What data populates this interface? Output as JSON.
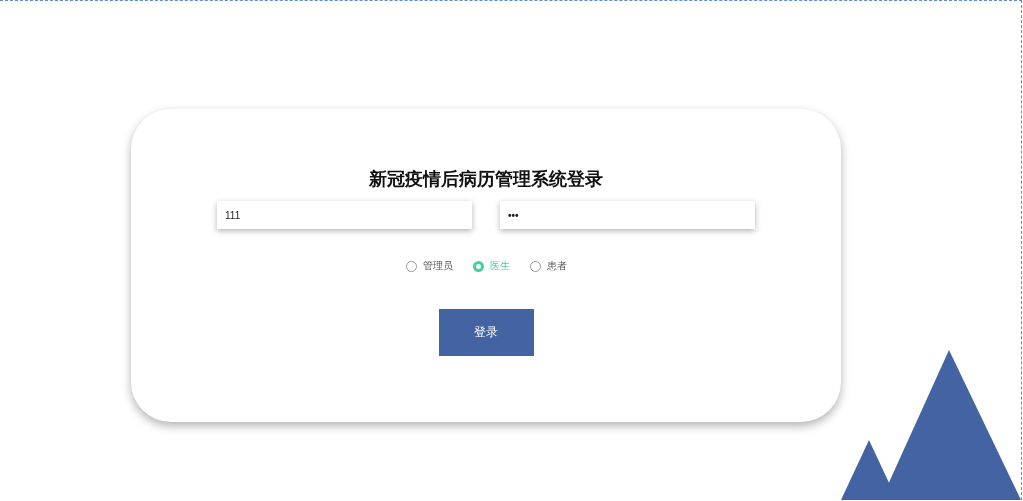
{
  "login_card": {
    "title": "新冠疫情后病历管理系统登录",
    "fields": [
      {
        "kind": "username",
        "value": "111"
      },
      {
        "kind": "password",
        "value": "•••"
      }
    ],
    "roles": [
      {
        "label": "管理员",
        "selected": false
      },
      {
        "label": "医生",
        "selected": true
      },
      {
        "label": "患者",
        "selected": false
      }
    ],
    "submit_button": "登录"
  }
}
